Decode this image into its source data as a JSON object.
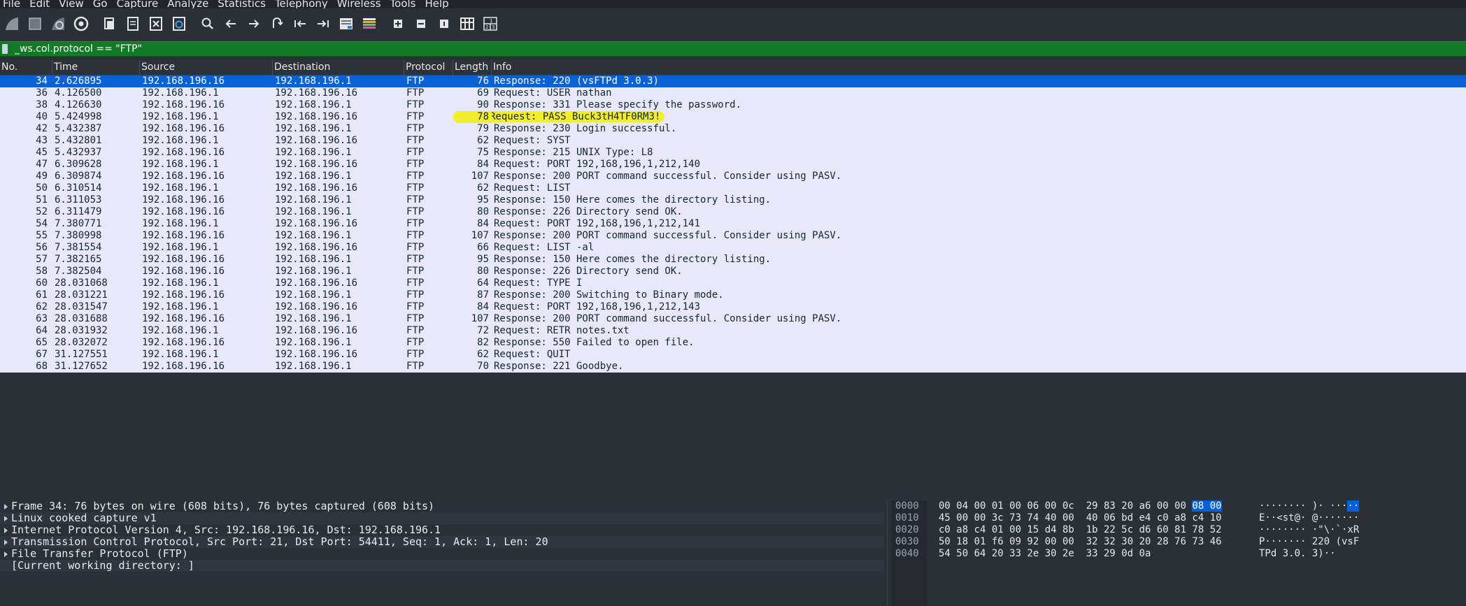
{
  "menu": [
    "File",
    "Edit",
    "View",
    "Go",
    "Capture",
    "Analyze",
    "Statistics",
    "Telephony",
    "Wireless",
    "Tools",
    "Help"
  ],
  "filter": {
    "value": "_ws.col.protocol == \"FTP\""
  },
  "columns": {
    "no": "No.",
    "time": "Time",
    "source": "Source",
    "destination": "Destination",
    "protocol": "Protocol",
    "length": "Length",
    "info": "Info"
  },
  "packets": [
    {
      "no": "34",
      "time": "2.626895",
      "src": "192.168.196.16",
      "dst": "192.168.196.1",
      "proto": "FTP",
      "len": "76",
      "info": "Response: 220 (vsFTPd 3.0.3)",
      "selected": true
    },
    {
      "no": "36",
      "time": "4.126500",
      "src": "192.168.196.1",
      "dst": "192.168.196.16",
      "proto": "FTP",
      "len": "69",
      "info": "Request: USER nathan"
    },
    {
      "no": "38",
      "time": "4.126630",
      "src": "192.168.196.16",
      "dst": "192.168.196.1",
      "proto": "FTP",
      "len": "90",
      "info": "Response: 331 Please specify the password."
    },
    {
      "no": "40",
      "time": "5.424998",
      "src": "192.168.196.1",
      "dst": "192.168.196.16",
      "proto": "FTP",
      "len": "78",
      "info": "Request: PASS Buck3tH4TF0RM3!",
      "highlight": true
    },
    {
      "no": "42",
      "time": "5.432387",
      "src": "192.168.196.16",
      "dst": "192.168.196.1",
      "proto": "FTP",
      "len": "79",
      "info": "Response: 230 Login successful."
    },
    {
      "no": "43",
      "time": "5.432801",
      "src": "192.168.196.1",
      "dst": "192.168.196.16",
      "proto": "FTP",
      "len": "62",
      "info": "Request: SYST"
    },
    {
      "no": "45",
      "time": "5.432937",
      "src": "192.168.196.16",
      "dst": "192.168.196.1",
      "proto": "FTP",
      "len": "75",
      "info": "Response: 215 UNIX Type: L8"
    },
    {
      "no": "47",
      "time": "6.309628",
      "src": "192.168.196.1",
      "dst": "192.168.196.16",
      "proto": "FTP",
      "len": "84",
      "info": "Request: PORT 192,168,196,1,212,140"
    },
    {
      "no": "49",
      "time": "6.309874",
      "src": "192.168.196.16",
      "dst": "192.168.196.1",
      "proto": "FTP",
      "len": "107",
      "info": "Response: 200 PORT command successful. Consider using PASV."
    },
    {
      "no": "50",
      "time": "6.310514",
      "src": "192.168.196.1",
      "dst": "192.168.196.16",
      "proto": "FTP",
      "len": "62",
      "info": "Request: LIST"
    },
    {
      "no": "51",
      "time": "6.311053",
      "src": "192.168.196.16",
      "dst": "192.168.196.1",
      "proto": "FTP",
      "len": "95",
      "info": "Response: 150 Here comes the directory listing."
    },
    {
      "no": "52",
      "time": "6.311479",
      "src": "192.168.196.16",
      "dst": "192.168.196.1",
      "proto": "FTP",
      "len": "80",
      "info": "Response: 226 Directory send OK."
    },
    {
      "no": "54",
      "time": "7.380771",
      "src": "192.168.196.1",
      "dst": "192.168.196.16",
      "proto": "FTP",
      "len": "84",
      "info": "Request: PORT 192,168,196,1,212,141"
    },
    {
      "no": "55",
      "time": "7.380998",
      "src": "192.168.196.16",
      "dst": "192.168.196.1",
      "proto": "FTP",
      "len": "107",
      "info": "Response: 200 PORT command successful. Consider using PASV."
    },
    {
      "no": "56",
      "time": "7.381554",
      "src": "192.168.196.1",
      "dst": "192.168.196.16",
      "proto": "FTP",
      "len": "66",
      "info": "Request: LIST -al"
    },
    {
      "no": "57",
      "time": "7.382165",
      "src": "192.168.196.16",
      "dst": "192.168.196.1",
      "proto": "FTP",
      "len": "95",
      "info": "Response: 150 Here comes the directory listing."
    },
    {
      "no": "58",
      "time": "7.382504",
      "src": "192.168.196.16",
      "dst": "192.168.196.1",
      "proto": "FTP",
      "len": "80",
      "info": "Response: 226 Directory send OK."
    },
    {
      "no": "60",
      "time": "28.031068",
      "src": "192.168.196.1",
      "dst": "192.168.196.16",
      "proto": "FTP",
      "len": "64",
      "info": "Request: TYPE I"
    },
    {
      "no": "61",
      "time": "28.031221",
      "src": "192.168.196.16",
      "dst": "192.168.196.1",
      "proto": "FTP",
      "len": "87",
      "info": "Response: 200 Switching to Binary mode."
    },
    {
      "no": "62",
      "time": "28.031547",
      "src": "192.168.196.1",
      "dst": "192.168.196.16",
      "proto": "FTP",
      "len": "84",
      "info": "Request: PORT 192,168,196,1,212,143"
    },
    {
      "no": "63",
      "time": "28.031688",
      "src": "192.168.196.16",
      "dst": "192.168.196.1",
      "proto": "FTP",
      "len": "107",
      "info": "Response: 200 PORT command successful. Consider using PASV."
    },
    {
      "no": "64",
      "time": "28.031932",
      "src": "192.168.196.1",
      "dst": "192.168.196.16",
      "proto": "FTP",
      "len": "72",
      "info": "Request: RETR notes.txt"
    },
    {
      "no": "65",
      "time": "28.032072",
      "src": "192.168.196.16",
      "dst": "192.168.196.1",
      "proto": "FTP",
      "len": "82",
      "info": "Response: 550 Failed to open file."
    },
    {
      "no": "67",
      "time": "31.127551",
      "src": "192.168.196.1",
      "dst": "192.168.196.16",
      "proto": "FTP",
      "len": "62",
      "info": "Request: QUIT"
    },
    {
      "no": "68",
      "time": "31.127652",
      "src": "192.168.196.16",
      "dst": "192.168.196.1",
      "proto": "FTP",
      "len": "70",
      "info": "Response: 221 Goodbye."
    }
  ],
  "details": [
    {
      "text": "Frame 34: 76 bytes on wire (608 bits), 76 bytes captured (608 bits)",
      "expandable": true
    },
    {
      "text": "Linux cooked capture v1",
      "expandable": true
    },
    {
      "text": "Internet Protocol Version 4, Src: 192.168.196.16, Dst: 192.168.196.1",
      "expandable": true
    },
    {
      "text": "Transmission Control Protocol, Src Port: 21, Dst Port: 54411, Seq: 1, Ack: 1, Len: 20",
      "expandable": true
    },
    {
      "text": "File Transfer Protocol (FTP)",
      "expandable": true
    },
    {
      "text": "[Current working directory: ]",
      "expandable": false
    }
  ],
  "bytes": [
    {
      "offset": "0000",
      "hex_pre": "00 04 00 01 00 06 00 0c  29 83 20 a6 00 00 ",
      "hex_sel": "08 00",
      "ascii_pre": "········ )· ···",
      "ascii_sel": "··"
    },
    {
      "offset": "0010",
      "hex_pre": "45 00 00 3c 73 74 40 00  40 06 bd e4 c0 a8 c4 10",
      "hex_sel": "",
      "ascii_pre": "E··<st@· @·······",
      "ascii_sel": ""
    },
    {
      "offset": "0020",
      "hex_pre": "c0 a8 c4 01 00 15 d4 8b  1b 22 5c d6 60 81 78 52",
      "hex_sel": "",
      "ascii_pre": "········ ·\"\\·`·xR",
      "ascii_sel": ""
    },
    {
      "offset": "0030",
      "hex_pre": "50 18 01 f6 09 92 00 00  32 32 30 20 28 76 73 46",
      "hex_sel": "",
      "ascii_pre": "P······· 220 (vsF",
      "ascii_sel": ""
    },
    {
      "offset": "0040",
      "hex_pre": "54 50 64 20 33 2e 30 2e  33 29 0d 0a",
      "hex_sel": "",
      "ascii_pre": "TPd 3.0. 3)··",
      "ascii_sel": ""
    }
  ]
}
